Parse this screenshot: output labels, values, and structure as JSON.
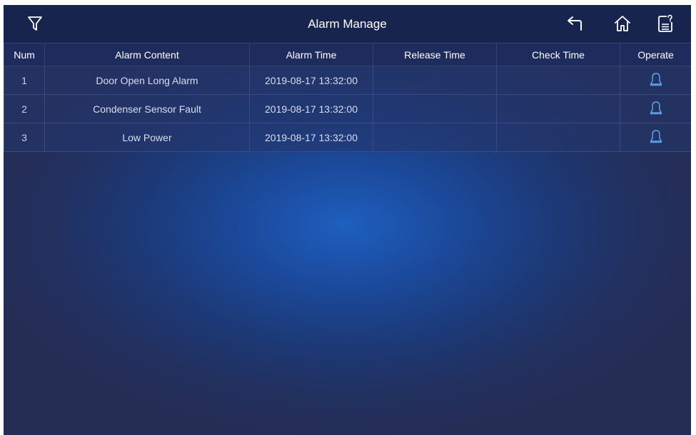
{
  "header": {
    "title": "Alarm Manage",
    "filter_icon": "filter-icon",
    "back_icon": "back-arrow-icon",
    "home_icon": "home-icon",
    "help_icon": "document-help-icon"
  },
  "table": {
    "columns": [
      "Num",
      "Alarm Content",
      "Alarm Time",
      "Release Time",
      "Check Time",
      "Operate"
    ],
    "rows": [
      {
        "num": "1",
        "content": "Door Open Long Alarm",
        "alarm_time": "2019-08-17 13:32:00",
        "release_time": "",
        "check_time": "",
        "operate_icon": "bell-icon"
      },
      {
        "num": "2",
        "content": "Condenser Sensor Fault",
        "alarm_time": "2019-08-17 13:32:00",
        "release_time": "",
        "check_time": "",
        "operate_icon": "bell-icon"
      },
      {
        "num": "3",
        "content": "Low Power",
        "alarm_time": "2019-08-17 13:32:00",
        "release_time": "",
        "check_time": "",
        "operate_icon": "bell-icon"
      }
    ]
  },
  "colors": {
    "header_bg": "#17244e",
    "background_center": "#1e5fbf",
    "background_edge": "#252d55",
    "icon_white": "#ffffff",
    "bell_blue": "#5aa8f0"
  }
}
